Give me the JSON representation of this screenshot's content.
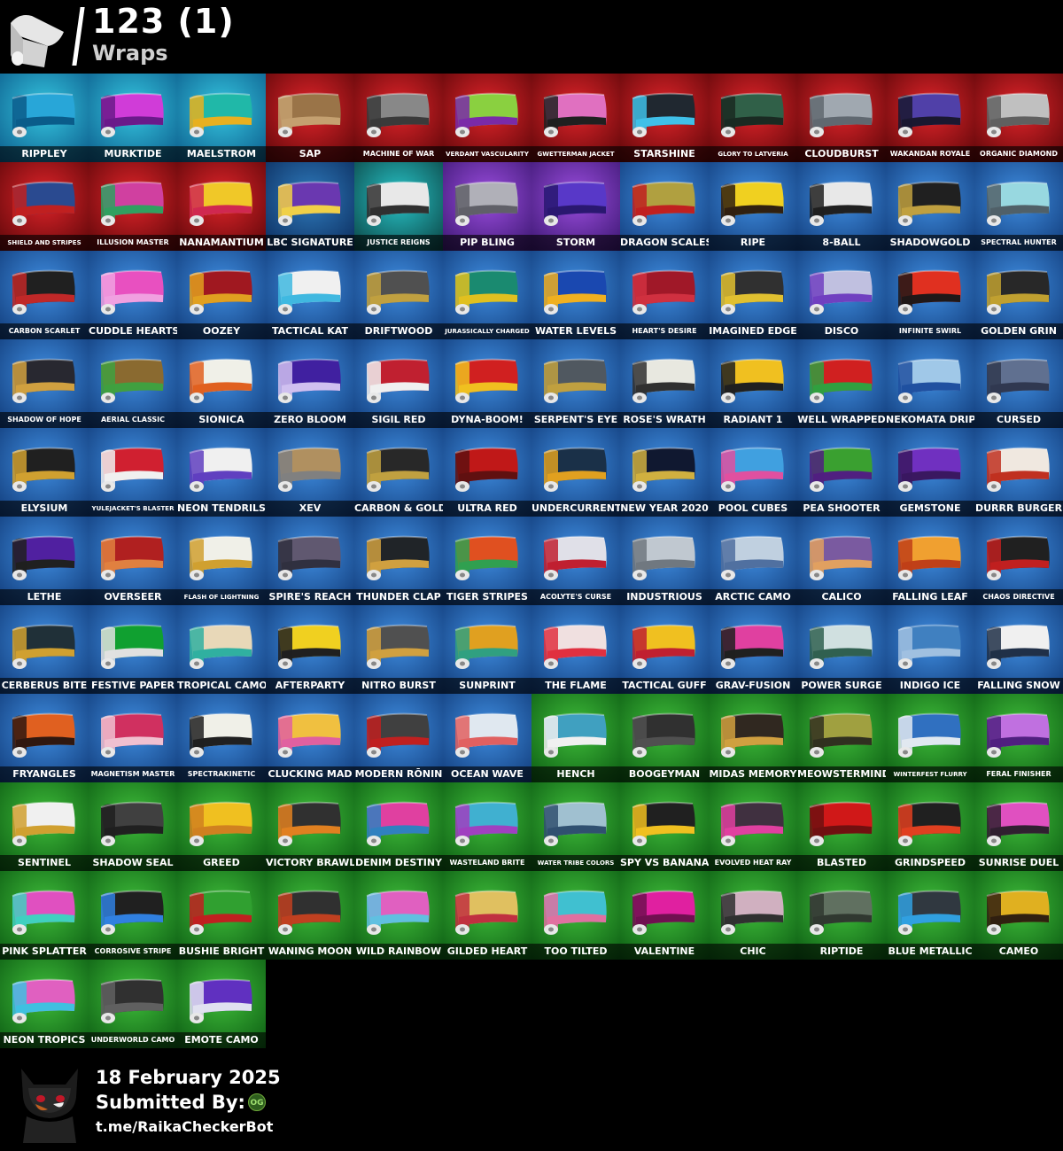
{
  "header": {
    "count": "123 (1)",
    "category": "Wraps"
  },
  "rarity_colors": {
    "icon": [
      "#35c6e0",
      "#0b5a8a"
    ],
    "marvel": [
      "#e0242a",
      "#5a0608"
    ],
    "dc": [
      "#2f7bbd",
      "#0a2a5a"
    ],
    "idol": [
      "#28c4c8",
      "#0a4040"
    ],
    "dark": [
      "#9b4dde",
      "#3a1670"
    ],
    "rare": [
      "#3f8de0",
      "#103a78"
    ],
    "uncommon": [
      "#3fbd3a",
      "#0b5a12"
    ]
  },
  "wraps": [
    {
      "name": "RIPPLEY",
      "rarity": "icon",
      "colors": [
        "#28a6d8",
        "#0a5c8a"
      ]
    },
    {
      "name": "MURKTIDE",
      "rarity": "icon",
      "colors": [
        "#d03cd8",
        "#6a1a8a"
      ]
    },
    {
      "name": "MAELSTROM",
      "rarity": "icon",
      "colors": [
        "#20b8a8",
        "#e8b020"
      ]
    },
    {
      "name": "SAP",
      "rarity": "marvel",
      "colors": [
        "#9a7448",
        "#c4a070"
      ]
    },
    {
      "name": "MACHINE OF WAR",
      "rarity": "marvel",
      "colors": [
        "#888888",
        "#3a3a3a"
      ]
    },
    {
      "name": "VERDANT VASCULARITY",
      "rarity": "marvel",
      "colors": [
        "#8ad040",
        "#7a2aa8"
      ]
    },
    {
      "name": "GWETTERMAN JACKET",
      "rarity": "marvel",
      "colors": [
        "#e070c0",
        "#202020"
      ]
    },
    {
      "name": "STARSHINE",
      "rarity": "marvel",
      "colors": [
        "#202830",
        "#40c0e8"
      ]
    },
    {
      "name": "GLORY TO LATVERIA",
      "rarity": "marvel",
      "colors": [
        "#306048",
        "#1a2a22"
      ]
    },
    {
      "name": "CLOUDBURST",
      "rarity": "marvel",
      "colors": [
        "#a0a8b0",
        "#606870"
      ]
    },
    {
      "name": "WAKANDAN ROYALE",
      "rarity": "marvel",
      "colors": [
        "#5040a8",
        "#1a1830"
      ]
    },
    {
      "name": "ORGANIC DIAMOND",
      "rarity": "marvel",
      "colors": [
        "#c0c0c0",
        "#606060"
      ]
    },
    {
      "name": "SHIELD AND STRIPES",
      "rarity": "marvel",
      "colors": [
        "#2a4a90",
        "#c02020"
      ]
    },
    {
      "name": "ILLUSION MASTER",
      "rarity": "marvel",
      "colors": [
        "#d040a0",
        "#30a060"
      ]
    },
    {
      "name": "NANAMANTIUM",
      "rarity": "marvel",
      "colors": [
        "#f0c828",
        "#d02850"
      ]
    },
    {
      "name": "LBC SIGNATURE",
      "rarity": "dc",
      "colors": [
        "#6a38b0",
        "#f0d048"
      ]
    },
    {
      "name": "JUSTICE REIGNS",
      "rarity": "idol",
      "colors": [
        "#e8e8e8",
        "#303030"
      ]
    },
    {
      "name": "PIP BLING",
      "rarity": "dark",
      "colors": [
        "#b0b0b8",
        "#606068"
      ]
    },
    {
      "name": "STORM",
      "rarity": "dark",
      "colors": [
        "#5838c8",
        "#2a1870"
      ]
    },
    {
      "name": "DRAGON SCALES",
      "rarity": "rare",
      "colors": [
        "#b0a040",
        "#c02020"
      ]
    },
    {
      "name": "RIPE",
      "rarity": "rare",
      "colors": [
        "#f0d020",
        "#302010"
      ]
    },
    {
      "name": "8-BALL",
      "rarity": "rare",
      "colors": [
        "#e8e8e8",
        "#202020"
      ]
    },
    {
      "name": "SHADOWGOLD",
      "rarity": "rare",
      "colors": [
        "#202020",
        "#c0a040"
      ]
    },
    {
      "name": "SPECTRAL HUNTER",
      "rarity": "rare",
      "colors": [
        "#98d8e0",
        "#506068"
      ]
    },
    {
      "name": "CARBON SCARLET",
      "rarity": "rare",
      "colors": [
        "#202020",
        "#c02828"
      ]
    },
    {
      "name": "CUDDLE HEARTS",
      "rarity": "rare",
      "colors": [
        "#e850c0",
        "#f0a0e0"
      ]
    },
    {
      "name": "OOZEY",
      "rarity": "rare",
      "colors": [
        "#a01820",
        "#e0a020"
      ]
    },
    {
      "name": "TACTICAL KAT",
      "rarity": "rare",
      "colors": [
        "#f0f0f0",
        "#40b8e0"
      ]
    },
    {
      "name": "DRIFTWOOD",
      "rarity": "rare",
      "colors": [
        "#505050",
        "#c0a040"
      ]
    },
    {
      "name": "JURASSICALLY CHARGED",
      "rarity": "rare",
      "colors": [
        "#1a8a70",
        "#e0c020"
      ]
    },
    {
      "name": "WATER LEVELS",
      "rarity": "rare",
      "colors": [
        "#1a48b0",
        "#f0b020"
      ]
    },
    {
      "name": "HEART'S DESIRE",
      "rarity": "rare",
      "colors": [
        "#a01828",
        "#d03040"
      ]
    },
    {
      "name": "IMAGINED EDGE",
      "rarity": "rare",
      "colors": [
        "#303030",
        "#e0c030"
      ]
    },
    {
      "name": "DISCO",
      "rarity": "rare",
      "colors": [
        "#c0c0e0",
        "#7040c0"
      ]
    },
    {
      "name": "INFINITE SWIRL",
      "rarity": "rare",
      "colors": [
        "#e03020",
        "#201818"
      ]
    },
    {
      "name": "GOLDEN GRIN",
      "rarity": "rare",
      "colors": [
        "#282828",
        "#c0a030"
      ]
    },
    {
      "name": "SHADOW OF HOPE",
      "rarity": "rare",
      "colors": [
        "#282830",
        "#d0a040"
      ]
    },
    {
      "name": "AERIAL CLASSIC",
      "rarity": "rare",
      "colors": [
        "#8a6a30",
        "#40a040"
      ]
    },
    {
      "name": "SIONICA",
      "rarity": "rare",
      "colors": [
        "#f0f0e8",
        "#e06020"
      ]
    },
    {
      "name": "ZERO BLOOM",
      "rarity": "rare",
      "colors": [
        "#4020a0",
        "#d0c0f0"
      ]
    },
    {
      "name": "SIGIL RED",
      "rarity": "rare",
      "colors": [
        "#c02030",
        "#f0f0f0"
      ]
    },
    {
      "name": "DYNA-BOOM!",
      "rarity": "rare",
      "colors": [
        "#d02020",
        "#f0c020"
      ]
    },
    {
      "name": "SERPENT'S EYE",
      "rarity": "rare",
      "colors": [
        "#505860",
        "#c0a040"
      ]
    },
    {
      "name": "ROSE'S WRATH",
      "rarity": "rare",
      "colors": [
        "#e8e8e0",
        "#303030"
      ]
    },
    {
      "name": "RADIANT 1",
      "rarity": "rare",
      "colors": [
        "#f0c020",
        "#202020"
      ]
    },
    {
      "name": "WELL WRAPPED",
      "rarity": "rare",
      "colors": [
        "#d02020",
        "#30a040"
      ]
    },
    {
      "name": "NEKOMATA DRIP",
      "rarity": "rare",
      "colors": [
        "#a0c8e8",
        "#2050a0"
      ]
    },
    {
      "name": "CURSED",
      "rarity": "rare",
      "colors": [
        "#607090",
        "#303850"
      ]
    },
    {
      "name": "ELYSIUM",
      "rarity": "rare",
      "colors": [
        "#202020",
        "#d0a030"
      ]
    },
    {
      "name": "YULEJACKET'S BLASTER",
      "rarity": "rare",
      "colors": [
        "#d02030",
        "#f0f0f0"
      ]
    },
    {
      "name": "NEON TENDRILS",
      "rarity": "rare",
      "colors": [
        "#f0f0f0",
        "#6040c0"
      ]
    },
    {
      "name": "XEV",
      "rarity": "rare",
      "colors": [
        "#b09060",
        "#808080"
      ]
    },
    {
      "name": "CARBON & GOLD",
      "rarity": "rare",
      "colors": [
        "#282828",
        "#c0a040"
      ]
    },
    {
      "name": "ULTRA RED",
      "rarity": "rare",
      "colors": [
        "#c01818",
        "#601010"
      ]
    },
    {
      "name": "UNDERCURRENT",
      "rarity": "rare",
      "colors": [
        "#1a3048",
        "#e0a020"
      ]
    },
    {
      "name": "NEW YEAR 2020",
      "rarity": "rare",
      "colors": [
        "#101830",
        "#d0b040"
      ]
    },
    {
      "name": "POOL CUBES",
      "rarity": "rare",
      "colors": [
        "#40a0e0",
        "#e050a0"
      ]
    },
    {
      "name": "PEA SHOOTER",
      "rarity": "rare",
      "colors": [
        "#3aa030",
        "#502080"
      ]
    },
    {
      "name": "GEMSTONE",
      "rarity": "rare",
      "colors": [
        "#7030c0",
        "#3a1860"
      ]
    },
    {
      "name": "DURRR BURGER",
      "rarity": "rare",
      "colors": [
        "#f0e8e0",
        "#c03020"
      ]
    },
    {
      "name": "LETHE",
      "rarity": "rare",
      "colors": [
        "#5020a0",
        "#202020"
      ]
    },
    {
      "name": "OVERSEER",
      "rarity": "rare",
      "colors": [
        "#b02020",
        "#e08040"
      ]
    },
    {
      "name": "FLASH OF LIGHTNING",
      "rarity": "rare",
      "colors": [
        "#f0f0e8",
        "#d0a030"
      ]
    },
    {
      "name": "SPIRE'S REACH",
      "rarity": "rare",
      "colors": [
        "#605870",
        "#303040"
      ]
    },
    {
      "name": "THUNDER CLAP",
      "rarity": "rare",
      "colors": [
        "#202428",
        "#d0a040"
      ]
    },
    {
      "name": "TIGER STRIPES",
      "rarity": "rare",
      "colors": [
        "#e05020",
        "#30a050"
      ]
    },
    {
      "name": "ACOLYTE'S CURSE",
      "rarity": "rare",
      "colors": [
        "#e0e0e8",
        "#c02030"
      ]
    },
    {
      "name": "INDUSTRIOUS",
      "rarity": "rare",
      "colors": [
        "#c0c8d0",
        "#707880"
      ]
    },
    {
      "name": "ARCTIC CAMO",
      "rarity": "rare",
      "colors": [
        "#c0d0e0",
        "#5070a0"
      ]
    },
    {
      "name": "CALICO",
      "rarity": "rare",
      "colors": [
        "#7a5aa0",
        "#e0a060"
      ]
    },
    {
      "name": "FALLING LEAF",
      "rarity": "rare",
      "colors": [
        "#f0a030",
        "#c04018"
      ]
    },
    {
      "name": "CHAOS DIRECTIVE",
      "rarity": "rare",
      "colors": [
        "#202020",
        "#c02020"
      ]
    },
    {
      "name": "CERBERUS BITE",
      "rarity": "rare",
      "colors": [
        "#203038",
        "#d0a030"
      ]
    },
    {
      "name": "FESTIVE PAPER",
      "rarity": "rare",
      "colors": [
        "#10a030",
        "#e0e0e0"
      ]
    },
    {
      "name": "TROPICAL CAMO",
      "rarity": "rare",
      "colors": [
        "#e8d8b8",
        "#30b0a0"
      ]
    },
    {
      "name": "AFTERPARTY",
      "rarity": "rare",
      "colors": [
        "#f0d020",
        "#202020"
      ]
    },
    {
      "name": "NITRO BURST",
      "rarity": "rare",
      "colors": [
        "#505050",
        "#d0a040"
      ]
    },
    {
      "name": "SUNPRINT",
      "rarity": "rare",
      "colors": [
        "#e0a020",
        "#30a080"
      ]
    },
    {
      "name": "THE FLAME",
      "rarity": "rare",
      "colors": [
        "#f0e0e0",
        "#e03040"
      ]
    },
    {
      "name": "TACTICAL GUFF",
      "rarity": "rare",
      "colors": [
        "#f0c020",
        "#c02030"
      ]
    },
    {
      "name": "GRAV-FUSION",
      "rarity": "rare",
      "colors": [
        "#e040a0",
        "#202020"
      ]
    },
    {
      "name": "POWER SURGE",
      "rarity": "rare",
      "colors": [
        "#d0e0e0",
        "#306050"
      ]
    },
    {
      "name": "INDIGO ICE",
      "rarity": "rare",
      "colors": [
        "#4080c0",
        "#a0c0e0"
      ]
    },
    {
      "name": "FALLING SNOW",
      "rarity": "rare",
      "colors": [
        "#f0f0f0",
        "#203048"
      ]
    },
    {
      "name": "FRYANGLES",
      "rarity": "rare",
      "colors": [
        "#e06020",
        "#301810"
      ]
    },
    {
      "name": "MAGNETISM MASTER",
      "rarity": "rare",
      "colors": [
        "#d03060",
        "#f0c0d0"
      ]
    },
    {
      "name": "SPECTRAKINETIC",
      "rarity": "rare",
      "colors": [
        "#f0f0e8",
        "#202020"
      ]
    },
    {
      "name": "CLUCKING MAD",
      "rarity": "rare",
      "colors": [
        "#f0c040",
        "#e060a0"
      ]
    },
    {
      "name": "MODERN RŌNIN",
      "rarity": "rare",
      "colors": [
        "#404040",
        "#c02020"
      ]
    },
    {
      "name": "OCEAN WAVE",
      "rarity": "rare",
      "colors": [
        "#e0e8f0",
        "#e06060"
      ]
    },
    {
      "name": "HENCH",
      "rarity": "uncommon",
      "colors": [
        "#40a0c0",
        "#f0f0f0"
      ]
    },
    {
      "name": "BOOGEYMAN",
      "rarity": "uncommon",
      "colors": [
        "#303030",
        "#505050"
      ]
    },
    {
      "name": "MIDAS MEMORY",
      "rarity": "uncommon",
      "colors": [
        "#302820",
        "#d0a040"
      ]
    },
    {
      "name": "MEOWSTERMIND",
      "rarity": "uncommon",
      "colors": [
        "#a0a040",
        "#303020"
      ]
    },
    {
      "name": "WINTERFEST FLURRY",
      "rarity": "uncommon",
      "colors": [
        "#3070c0",
        "#e0e8f0"
      ]
    },
    {
      "name": "FERAL FINISHER",
      "rarity": "uncommon",
      "colors": [
        "#c070e0",
        "#502080"
      ]
    },
    {
      "name": "SENTINEL",
      "rarity": "uncommon",
      "colors": [
        "#f0f0f0",
        "#d0a030"
      ]
    },
    {
      "name": "SHADOW SEAL",
      "rarity": "uncommon",
      "colors": [
        "#404040",
        "#202020"
      ]
    },
    {
      "name": "GREED",
      "rarity": "uncommon",
      "colors": [
        "#f0c020",
        "#d08020"
      ]
    },
    {
      "name": "VICTORY BRAWL",
      "rarity": "uncommon",
      "colors": [
        "#303030",
        "#e08020"
      ]
    },
    {
      "name": "DENIM DESTINY",
      "rarity": "uncommon",
      "colors": [
        "#e040a0",
        "#3080c0"
      ]
    },
    {
      "name": "WASTELAND BRITE",
      "rarity": "uncommon",
      "colors": [
        "#40b0d0",
        "#a040c0"
      ]
    },
    {
      "name": "WATER TRIBE COLORS",
      "rarity": "uncommon",
      "colors": [
        "#a0c0d0",
        "#305070"
      ]
    },
    {
      "name": "SPY VS BANANA",
      "rarity": "uncommon",
      "colors": [
        "#202020",
        "#f0c020"
      ]
    },
    {
      "name": "EVOLVED HEAT RAY",
      "rarity": "uncommon",
      "colors": [
        "#403040",
        "#e040a0"
      ]
    },
    {
      "name": "BLASTED",
      "rarity": "uncommon",
      "colors": [
        "#d01818",
        "#701010"
      ]
    },
    {
      "name": "GRINDSPEED",
      "rarity": "uncommon",
      "colors": [
        "#202020",
        "#e04020"
      ]
    },
    {
      "name": "SUNRISE DUEL",
      "rarity": "uncommon",
      "colors": [
        "#e050c0",
        "#302030"
      ]
    },
    {
      "name": "PINK SPLATTER",
      "rarity": "uncommon",
      "colors": [
        "#e050c0",
        "#40d0c0"
      ]
    },
    {
      "name": "CORROSIVE STRIPE",
      "rarity": "uncommon",
      "colors": [
        "#202020",
        "#3080e0"
      ]
    },
    {
      "name": "BUSHIE BRIGHT",
      "rarity": "uncommon",
      "colors": [
        "#30a030",
        "#c02020"
      ]
    },
    {
      "name": "WANING MOON",
      "rarity": "uncommon",
      "colors": [
        "#303030",
        "#c04020"
      ]
    },
    {
      "name": "WILD RAINBOW",
      "rarity": "uncommon",
      "colors": [
        "#e060c0",
        "#60c0e0"
      ]
    },
    {
      "name": "GILDED HEART",
      "rarity": "uncommon",
      "colors": [
        "#e0c060",
        "#c03040"
      ]
    },
    {
      "name": "TOO TILTED",
      "rarity": "uncommon",
      "colors": [
        "#40c0d0",
        "#e070a0"
      ]
    },
    {
      "name": "VALENTINE",
      "rarity": "uncommon",
      "colors": [
        "#e020a0",
        "#701050"
      ]
    },
    {
      "name": "CHIC",
      "rarity": "uncommon",
      "colors": [
        "#d0b0c0",
        "#303030"
      ]
    },
    {
      "name": "RIPTIDE",
      "rarity": "uncommon",
      "colors": [
        "#607060",
        "#303830"
      ]
    },
    {
      "name": "BLUE METALLIC",
      "rarity": "uncommon",
      "colors": [
        "#303840",
        "#30a0e0"
      ]
    },
    {
      "name": "CAMEO",
      "rarity": "uncommon",
      "colors": [
        "#e0b020",
        "#302010"
      ]
    },
    {
      "name": "NEON TROPICS",
      "rarity": "uncommon",
      "colors": [
        "#e060c0",
        "#40c0e0"
      ]
    },
    {
      "name": "UNDERWORLD CAMO",
      "rarity": "uncommon",
      "colors": [
        "#303030",
        "#606060"
      ]
    },
    {
      "name": "EMOTE CAMO",
      "rarity": "uncommon",
      "colors": [
        "#6030c0",
        "#e0e0f0"
      ]
    }
  ],
  "footer": {
    "date": "18 February 2025",
    "submitted_label": "Submitted By:",
    "badge": "OG",
    "link": "t.me/RaikaCheckerBot"
  }
}
